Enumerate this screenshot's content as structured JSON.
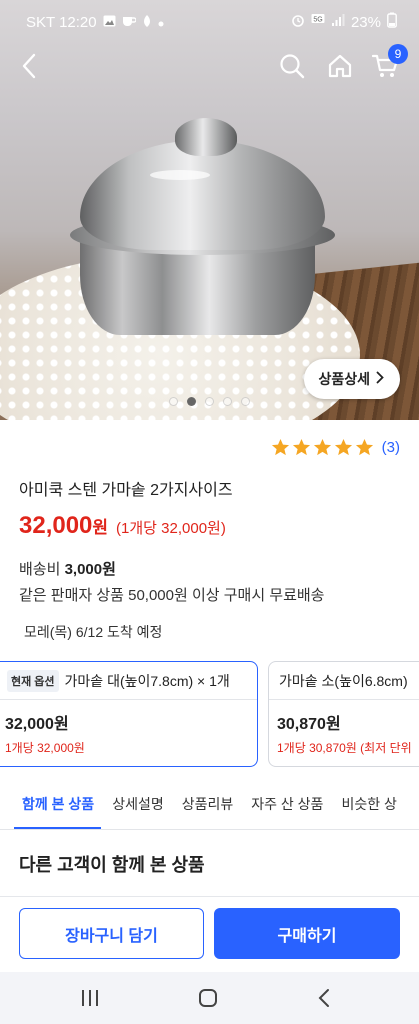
{
  "status_bar": {
    "carrier_time": "SKT 12:20",
    "battery": "23%",
    "icons": [
      "gallery-icon",
      "cup-icon",
      "leaf-icon",
      "dot-icon",
      "alarm-icon",
      "5g-icon",
      "signal-icon",
      "battery-icon"
    ]
  },
  "top_bar": {
    "cart_count": "9",
    "icons": [
      "back-arrow-icon",
      "search-icon",
      "home-icon",
      "cart-icon"
    ]
  },
  "hero": {
    "detail_button_label": "상품상세",
    "carousel_total": 5,
    "carousel_active": 2
  },
  "product": {
    "rating_stars": 5,
    "review_count": "(3)",
    "title": "아미쿡 스텐 가마솥 2가지사이즈",
    "price_number": "32,000",
    "price_currency": "원",
    "unit_price": "(1개당 32,000원)",
    "shipping_label": "배송비 ",
    "shipping_fee": "3,000원",
    "free_shipping_note": "같은 판매자 상품 50,000원 이상 구매시 무료배송",
    "delivery_eta": "모레(목) 6/12 도착 예정"
  },
  "options": [
    {
      "tag": "현재 옵션",
      "name": "가마솥 대(높이7.8cm) × 1개",
      "price": "32,000원",
      "unit": "1개당 32,000원"
    },
    {
      "tag": "",
      "name": "가마솥 소(높이6.8cm)",
      "price": "30,870원",
      "unit": "1개당 30,870원 (최저 단위"
    }
  ],
  "tabs": [
    {
      "label": "함께 본 상품",
      "active": true
    },
    {
      "label": "상세설명",
      "active": false
    },
    {
      "label": "상품리뷰",
      "active": false
    },
    {
      "label": "자주 산 상품",
      "active": false
    },
    {
      "label": "비슷한 상",
      "active": false
    }
  ],
  "section_title": "다른 고객이 함께 본 상품",
  "actions": {
    "add_to_cart": "장바구니 담기",
    "buy_now": "구매하기"
  },
  "colors": {
    "accent": "#2962ff",
    "price_red": "#e0251b",
    "star": "#f5a623"
  },
  "nav_bar": {
    "icons": [
      "recent-apps-icon",
      "home-circle-icon",
      "back-chevron-icon"
    ]
  }
}
